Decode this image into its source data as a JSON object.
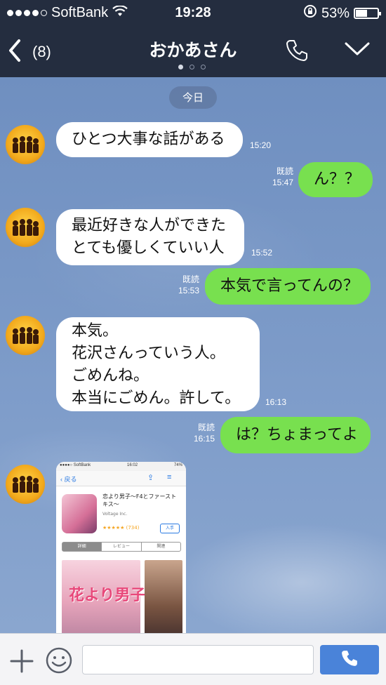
{
  "status_bar": {
    "carrier": "SoftBank",
    "time": "19:28",
    "battery": "53%",
    "battery_level": 0.53,
    "icons": [
      "signal-dots",
      "wifi-icon",
      "rotation-lock-icon",
      "battery-icon"
    ]
  },
  "header": {
    "back_count": "(8)",
    "title": "おかあさん",
    "page_count": 3,
    "active_page": 1,
    "icons": [
      "back-chevron-icon",
      "phone-icon",
      "chevron-down-icon"
    ]
  },
  "chat": {
    "date_label": "今日",
    "messages": [
      {
        "from": "them",
        "lines": [
          "ひとつ大事な話がある"
        ],
        "time": "15:20"
      },
      {
        "from": "me",
        "lines": [
          "ん？？"
        ],
        "read": "既読",
        "time": "15:47"
      },
      {
        "from": "them",
        "lines": [
          "最近好きな人ができた",
          "とても優しくていい人"
        ],
        "time": "15:52"
      },
      {
        "from": "me",
        "lines": [
          "本気で言ってんの？"
        ],
        "read": "既読",
        "time": "15:53"
      },
      {
        "from": "them",
        "lines": [
          "本気。",
          "花沢さんっていう人。",
          "ごめんね。",
          "本当にごめん。許して。"
        ],
        "time": "16:13"
      },
      {
        "from": "me",
        "lines": [
          "は？ちょまってよ"
        ],
        "read": "既読",
        "time": "16:15"
      }
    ],
    "image_message": {
      "status_carrier": "●●●●○ SoftBank",
      "status_time": "16:02",
      "status_battery": "74%",
      "back_label": "戻る",
      "app_title": "恋より男子〜F4とファーストキス〜",
      "developer": "Voltage Inc.",
      "rating_stars": "★★★★★ (734)",
      "get_label": "入手",
      "tabs": [
        "詳細",
        "レビュー",
        "関連"
      ],
      "active_tab": 0,
      "screenshot_text": "花より男子"
    }
  },
  "input_bar": {
    "placeholder": "",
    "icons": [
      "plus-icon",
      "smiley-icon",
      "send-icon"
    ],
    "accent": "#4a83d9"
  },
  "colors": {
    "header_bg": "#242d3f",
    "outgoing_bubble": "#78e04f",
    "incoming_bubble": "#ffffff",
    "chat_bg": "#7a98c6"
  }
}
